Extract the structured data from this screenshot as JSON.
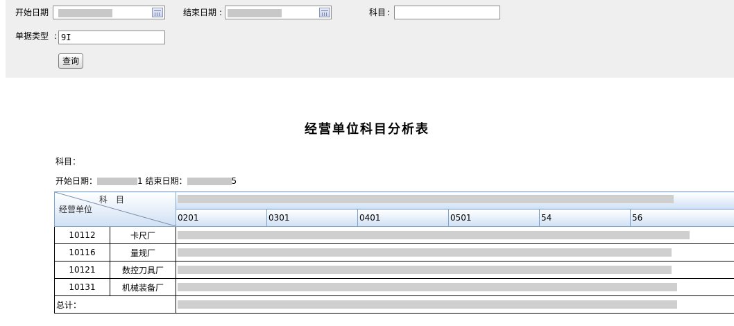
{
  "filters": {
    "start_date_label": "开始日期",
    "end_date_label": "结束日期",
    "subject_label": "科目",
    "subject_value": "",
    "doc_type_label": "单据类型",
    "doc_type_value": "9I",
    "query_button": "查询"
  },
  "report": {
    "title": "经营单位科目分析表",
    "subject_line": "科目：",
    "start_date_caption": "开始日期：",
    "end_date_fragment_left": "1",
    "end_date_caption": "结束日期：",
    "end_date_fragment_right": "5",
    "corner_subject": "科　目",
    "corner_unit": "经营单位",
    "codes": [
      "0201",
      "0301",
      "0401",
      "0501",
      "54",
      "56"
    ],
    "rows": [
      {
        "code": "10112",
        "name": "卡尺厂"
      },
      {
        "code": "10116",
        "name": "量规厂"
      },
      {
        "code": "10121",
        "name": "数控刀具厂"
      },
      {
        "code": "10131",
        "name": "机械装备厂"
      }
    ],
    "total_label": "总计："
  }
}
